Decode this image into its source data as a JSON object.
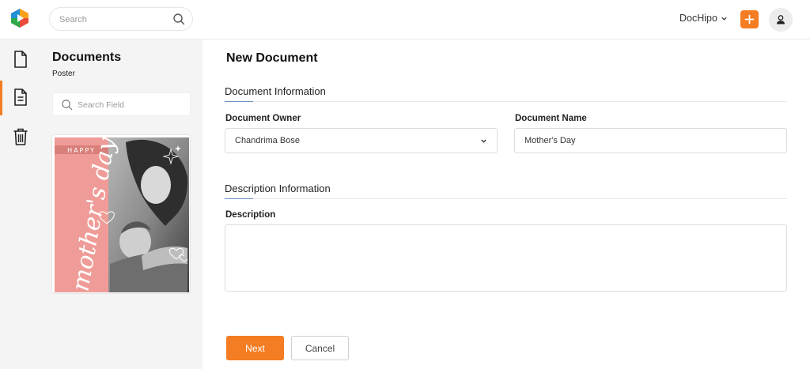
{
  "colors": {
    "accent": "#f47c22",
    "underline": "#6b95c6",
    "sidebar_bg": "#f4f4f4"
  },
  "topbar": {
    "search_placeholder": "Search",
    "brand_label": "DocHipo",
    "icons": {
      "logo": "dochipo-logo-icon",
      "search": "search-icon",
      "dropdown": "chevron-down-icon",
      "add": "plus-icon",
      "user": "user-icon"
    }
  },
  "rail": {
    "items": [
      {
        "name": "all-documents",
        "icon": "document-icon",
        "active": false
      },
      {
        "name": "documents",
        "icon": "document-lines-icon",
        "active": true
      },
      {
        "name": "trash",
        "icon": "trash-icon",
        "active": false
      }
    ]
  },
  "docs_panel": {
    "title": "Documents",
    "subtitle": "Poster",
    "search_placeholder": "Search Field",
    "thumbnail": {
      "top_text": "HAPPY",
      "script_text": "mother's day"
    }
  },
  "main": {
    "title": "New Document",
    "document_info": {
      "heading": "Document Information",
      "owner_label": "Document Owner",
      "owner_value": "Chandrima Bose",
      "name_label": "Document Name",
      "name_value": "Mother's Day"
    },
    "description_info": {
      "heading": "Description Information",
      "description_label": "Description",
      "description_value": ""
    },
    "buttons": {
      "next": "Next",
      "cancel": "Cancel"
    }
  }
}
